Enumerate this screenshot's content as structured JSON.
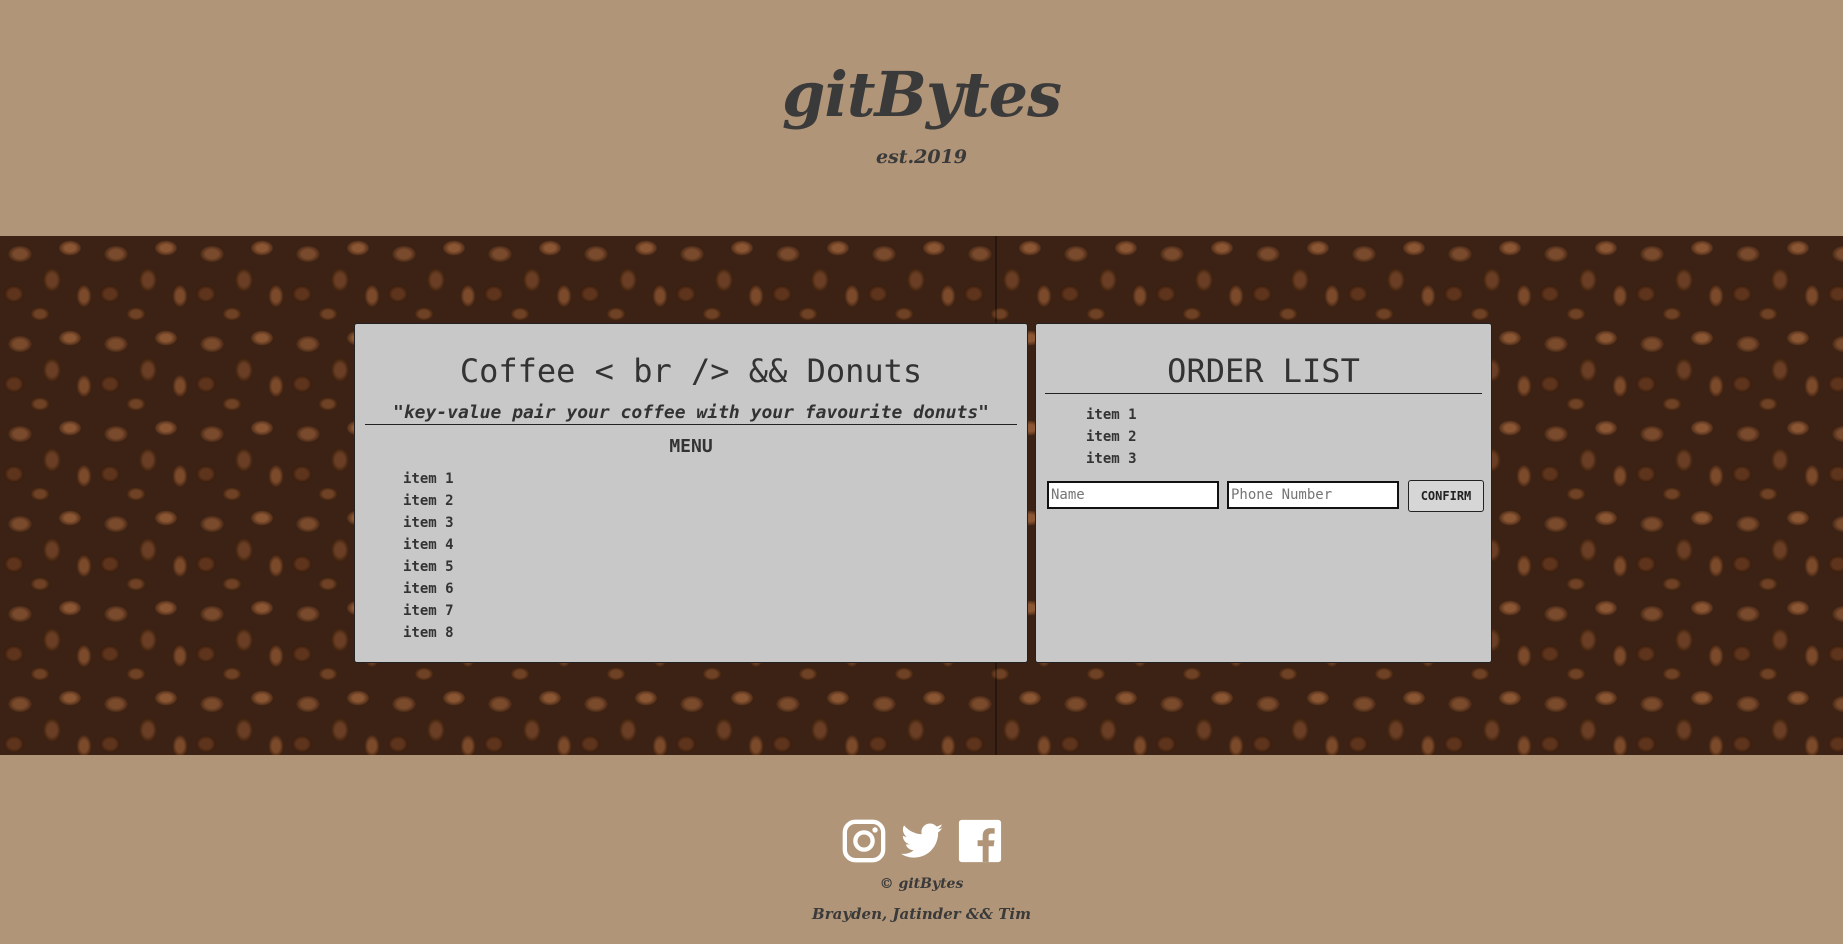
{
  "header": {
    "logo": "gitBytes",
    "established": "est.2019"
  },
  "menu_panel": {
    "title": "Coffee < br /> && Donuts",
    "tagline": "\"key-value pair your coffee with your favourite donuts\"",
    "menu_label": "MENU",
    "items": [
      "item 1",
      "item 2",
      "item 3",
      "item 4",
      "item 5",
      "item 6",
      "item 7",
      "item 8"
    ]
  },
  "order_panel": {
    "title": "ORDER LIST",
    "items": [
      "item 1",
      "item 2",
      "item 3"
    ],
    "name_placeholder": "Name",
    "phone_placeholder": "Phone Number",
    "confirm_label": "CONFIRM"
  },
  "footer": {
    "icons": [
      "instagram-icon",
      "twitter-icon",
      "facebook-icon"
    ],
    "copyright": "© gitBytes",
    "credits": "Brayden, Jatinder && Tim"
  },
  "colors": {
    "background": "#b09578",
    "panel": "#c8c8c8",
    "text": "#333333"
  }
}
